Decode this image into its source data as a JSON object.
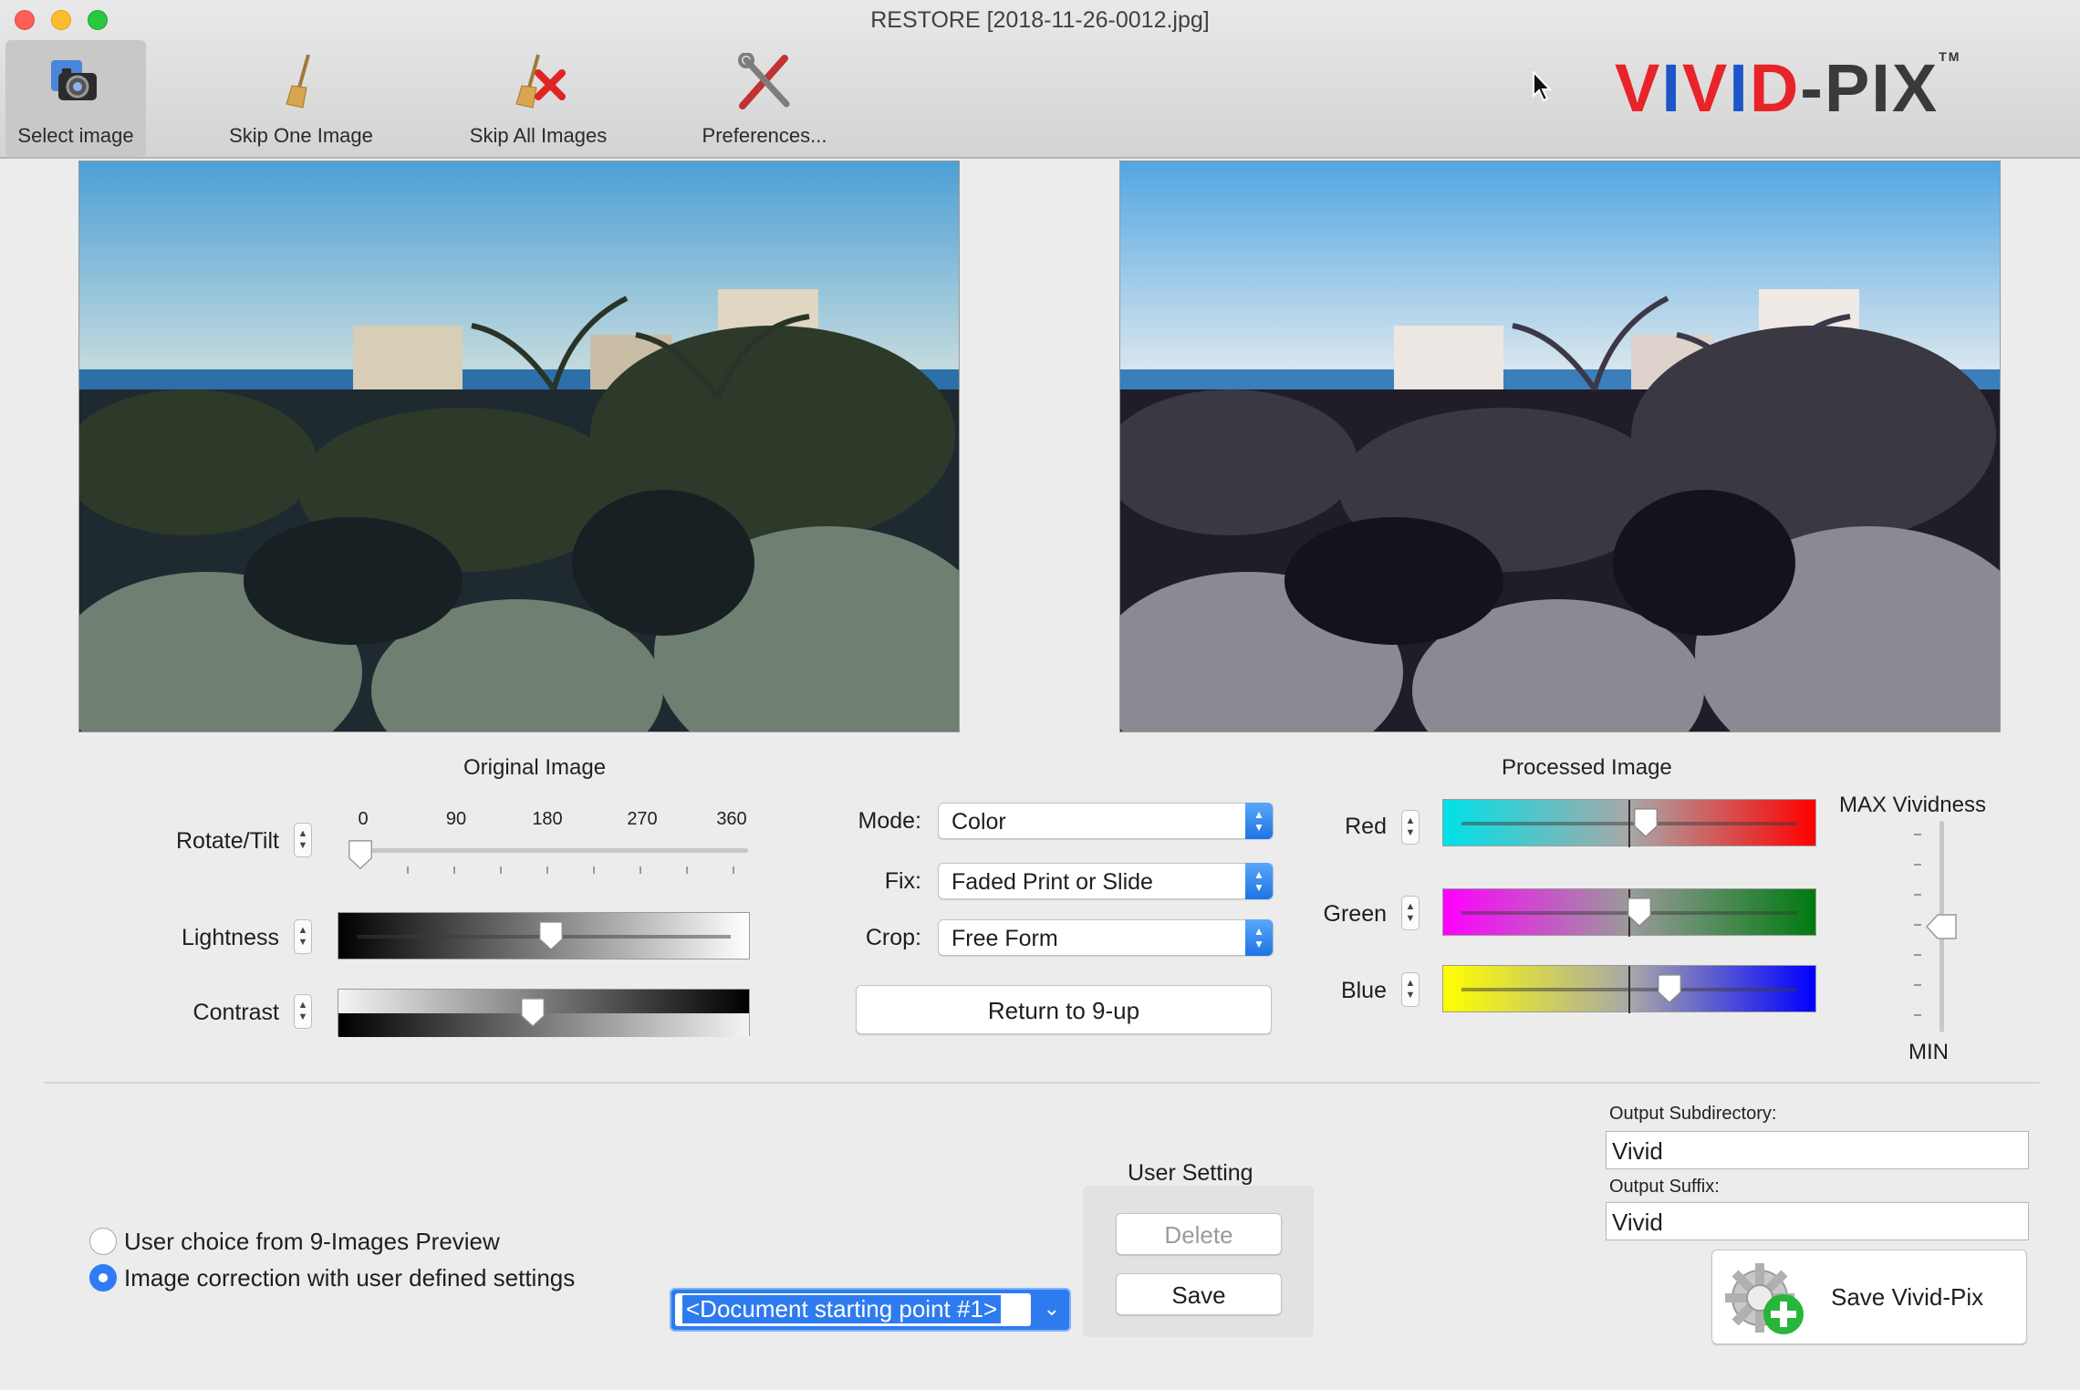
{
  "window": {
    "title": "RESTORE [2018-11-26-0012.jpg]"
  },
  "toolbar": {
    "select_image": "Select image",
    "skip_one": "Skip One Image",
    "skip_all": "Skip All Images",
    "preferences": "Preferences..."
  },
  "logo": {
    "text_v": "V",
    "text_i1": "I",
    "text_v2": "V",
    "text_i2": "I",
    "text_d": "D",
    "text_rest": "-PIX",
    "tm": "TM",
    "colors": {
      "red": "#e8232a",
      "blue": "#1d55c9",
      "dark": "#3a3a3a"
    }
  },
  "images": {
    "original_caption": "Original Image",
    "processed_caption": "Processed Image"
  },
  "controls": {
    "rotate": {
      "label": "Rotate/Tilt",
      "ticks": [
        "0",
        "90",
        "180",
        "270",
        "360"
      ],
      "value": 0
    },
    "lightness": {
      "label": "Lightness",
      "value": 0.52
    },
    "contrast": {
      "label": "Contrast",
      "value": 0.47
    },
    "mode": {
      "label": "Mode:",
      "value": "Color"
    },
    "fix": {
      "label": "Fix:",
      "value": "Faded Print or Slide"
    },
    "crop": {
      "label": "Crop:",
      "value": "Free Form"
    },
    "return_button": "Return to 9-up",
    "red": {
      "label": "Red",
      "value": 0.55
    },
    "green": {
      "label": "Green",
      "value": 0.53
    },
    "blue": {
      "label": "Blue",
      "value": 0.62
    },
    "vividness": {
      "max_label": "MAX Vividness",
      "min_label": "MIN",
      "value": 0.5
    }
  },
  "options": {
    "radio_nine": "User choice from 9-Images Preview",
    "radio_user": "Image correction with user defined settings",
    "selected": "user",
    "document_select": "<Document starting point #1>"
  },
  "user_setting": {
    "title": "User Setting",
    "delete": "Delete",
    "save": "Save"
  },
  "output": {
    "subdir_label": "Output Subdirectory:",
    "subdir_value": "Vivid",
    "suffix_label": "Output Suffix:",
    "suffix_value": "Vivid",
    "save_button": "Save Vivid-Pix"
  }
}
